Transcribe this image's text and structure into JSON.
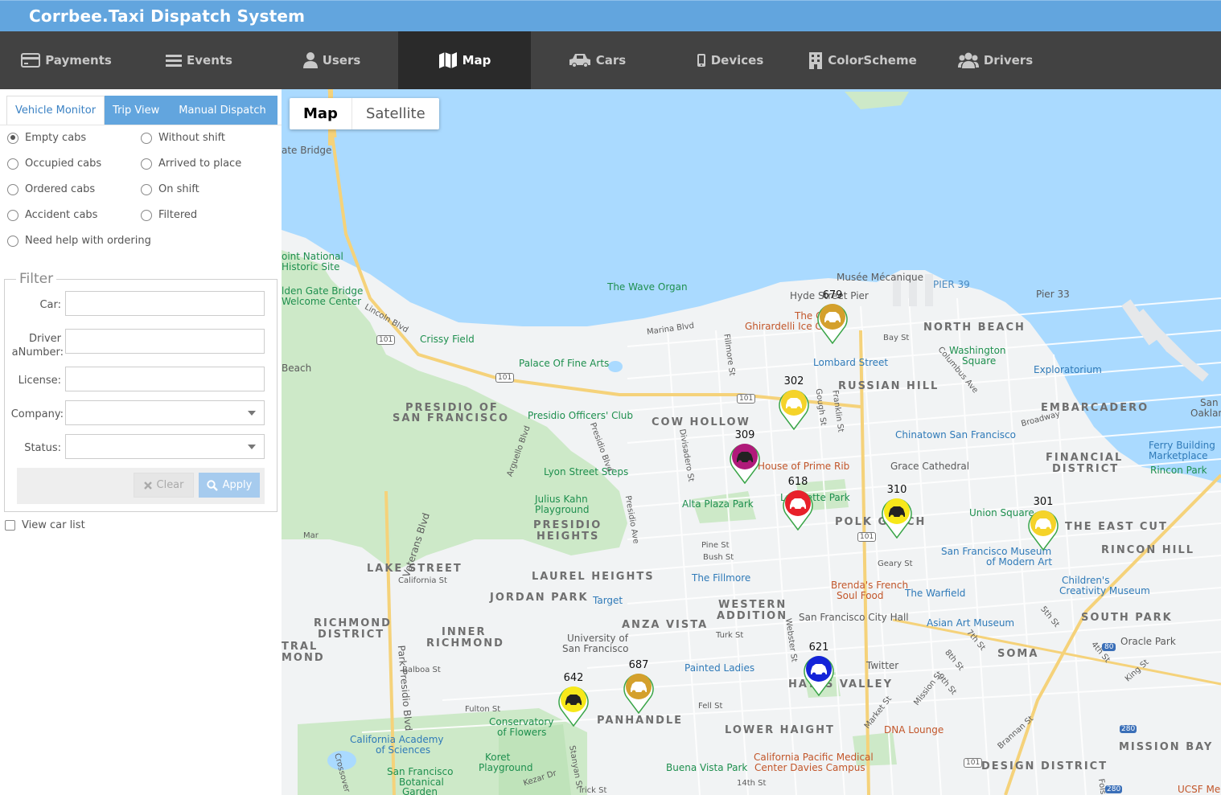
{
  "app": {
    "title": "Corrbee.Taxi Dispatch System"
  },
  "nav": [
    {
      "label": "Payments",
      "icon": "credit-card-icon",
      "active": false
    },
    {
      "label": "Events",
      "icon": "list-icon",
      "active": false
    },
    {
      "label": "Users",
      "icon": "user-icon",
      "active": false
    },
    {
      "label": "Map",
      "icon": "map-icon",
      "active": true
    },
    {
      "label": "Cars",
      "icon": "car-icon",
      "active": false
    },
    {
      "label": "Devices",
      "icon": "mobile-icon",
      "active": false
    },
    {
      "label": "ColorScheme",
      "icon": "building-icon",
      "active": false
    },
    {
      "label": "Drivers",
      "icon": "users-icon",
      "active": false
    }
  ],
  "sidebar": {
    "tabs": [
      "Vehicle Monitor",
      "Trip View",
      "Manual Dispatch"
    ],
    "active_tab": "Vehicle Monitor",
    "radios_left": [
      "Empty cabs",
      "Occupied cabs",
      "Ordered cabs",
      "Accident cabs",
      "Need help with ordering"
    ],
    "radios_right": [
      "Without shift",
      "Arrived to place",
      "On shift",
      "Filtered"
    ],
    "selected_radio": "Empty cabs",
    "filter": {
      "legend": "Filter",
      "car_label": "Car:",
      "driver_label_line1": "Driver",
      "driver_label_line2": "aNumber:",
      "license_label": "License:",
      "company_label": "Company:",
      "status_label": "Status:",
      "car_value": "",
      "driver_value": "",
      "license_value": "",
      "company_value": "",
      "status_value": "",
      "clear_label": "Clear",
      "apply_label": "Apply"
    },
    "view_car_list_label": "View car list"
  },
  "map": {
    "type_buttons": [
      "Map",
      "Satellite"
    ],
    "active_type": "Map",
    "markers": [
      {
        "number": "679",
        "color": "#d4a02c"
      },
      {
        "number": "302",
        "color": "#f5d32a"
      },
      {
        "number": "309",
        "color": "#b01a7a"
      },
      {
        "number": "618",
        "color": "#e8202a"
      },
      {
        "number": "310",
        "color": "#f7e81a"
      },
      {
        "number": "301",
        "color": "#f5d32a"
      },
      {
        "number": "621",
        "color": "#1424d8"
      },
      {
        "number": "687",
        "color": "#d4a02c"
      },
      {
        "number": "642",
        "color": "#f7e81a"
      }
    ],
    "labels": {
      "bridge": "ate Bridge",
      "historic1": "oint National",
      "historic2": "Historic Site",
      "gg1": "lden Gate Bridge",
      "gg2": "Welcome Center",
      "beach": "Beach",
      "wave": "The Wave Organ",
      "musee": "Musée Mécanique",
      "pier39": "PIER 39",
      "pier33": "Pier 33",
      "hyde": "Hyde Street Pier",
      "ghirardelli": "Ghirardelli Ice C",
      "the_c": "The C",
      "north_beach": "NORTH BEACH",
      "washington1": "Washington",
      "washington2": "Square",
      "lombard": "Lombard Street",
      "russian_hill": "RUSSIAN HILL",
      "exploratorium": "Exploratorium",
      "embarcadero": "EMBARCADERO",
      "crissy": "Crissy Field",
      "lincoln": "Lincoln Blvd",
      "marina": "Marina Blvd",
      "palace": "Palace Of Fine Arts",
      "presidio1": "PRESIDIO OF",
      "presidio2": "SAN FRANCISCO",
      "officers": "Presidio Officers' Club",
      "cow_hollow": "COW HOLLOW",
      "chinatown": "Chinatown San Francisco",
      "prime_rib": "House of Prime Rib",
      "grace": "Grace Cathedral",
      "financial1": "FINANCIAL",
      "financial2": "DISTRICT",
      "ferry1": "Ferry Building",
      "ferry2": "Marketplace",
      "rincon_park": "Rincon Park",
      "sf_oak1": "San F",
      "sf_oak2": "Oakland",
      "lyon": "Lyon Street Steps",
      "julius1": "Julius Kahn",
      "julius2": "Playground",
      "alta": "Alta Plaza Park",
      "lafayette": "Lafayette Park",
      "polk": "POLK GULCH",
      "union": "Union Square",
      "east_cut": "THE EAST CUT",
      "rincon_hill": "RINCON HILL",
      "sfmoma1": "San Francisco Museum",
      "sfmoma2": "of Modern Art",
      "childrens1": "Children's",
      "childrens2": "Creativity Museum",
      "presidio_heights1": "PRESIDIO",
      "presidio_heights2": "HEIGHTS",
      "lake": "LAKE STREET",
      "california": "California St",
      "laurel": "LAUREL HEIGHTS",
      "jordan": "JORDAN PARK",
      "target": "Target",
      "fillmore": "The Fillmore",
      "brendas1": "Brenda's French",
      "brendas2": "Soul Food",
      "warfield": "The Warfield",
      "western1": "WESTERN",
      "western2": "ADDITION",
      "city_hall": "San Francisco City Hall",
      "asian": "Asian Art Museum",
      "south_park": "SOUTH PARK",
      "oracle": "Oracle Park",
      "soma": "SOMA",
      "richmond1": "RICHMOND",
      "richmond2": "DISTRICT",
      "inner1": "INNER",
      "inner2": "RICHMOND",
      "anza": "ANZA VISTA",
      "usf1": "University of",
      "usf2": "San Francisco",
      "tral1": "TRAL",
      "tral2": "MOND",
      "painted": "Painted Ladies",
      "hayes": "HAYES VALLEY",
      "twitter": "Twitter",
      "panhandle": "PANHANDLE",
      "lower_haight": "LOWER HAIGHT",
      "dna": "DNA Lounge",
      "mission_bay": "MISSION BAY",
      "conservatory1": "Conservatory",
      "conservatory2": "of Flowers",
      "cal_academy1": "California Academy",
      "cal_academy2": "of Sciences",
      "koret1": "Koret",
      "koret2": "Playground",
      "botanical1": "San Francisco",
      "botanical2": "Botanical",
      "botanical3": "Garden",
      "buena": "Buena Vista Park",
      "cpmc1": "California Pacific Medical",
      "cpmc2": "Center Davies Campus",
      "design": "DESIGN DISTRICT",
      "ucsf": "UCSF Me",
      "divisadero": "Divisadero St",
      "fillmore_st": "Fillmore St",
      "franklin": "Franklin St",
      "veterans": "Veterans Blvd",
      "park_presidio": "Park Presidio Blvd",
      "broadway": "Broadway",
      "geary": "Geary St",
      "pine": "Pine St",
      "bush": "Bush St",
      "turk": "Turk St",
      "fell": "Fell St",
      "fulton": "Fulton St",
      "balboa": "Balboa St",
      "market": "Market St",
      "mission": "Mission St",
      "stanyan": "Stanyan St",
      "kezar": "Kezar Dr",
      "14th": "14th St",
      "bay": "Bay St",
      "columbus": "Columbus Ave",
      "hwy101": "101",
      "hwy80": "80",
      "hwy280": "280",
      "crossover": "Crossover",
      "king": "King St",
      "5th": "5th St",
      "4th": "4th St",
      "7th": "7th St",
      "8th": "8th St",
      "9th": "9th St",
      "brannan": "Brannan St",
      "arguello": "Arguello Blvd",
      "presidio_blvd": "Presidio Blvd",
      "presidio_ave": "Presidio Ave",
      "gough": "Gough St",
      "larkin": "Larkin St",
      "webster": "Webster St",
      "folsom": "Fols",
      "kirk": "irick St",
      "ma": "Mar"
    }
  }
}
